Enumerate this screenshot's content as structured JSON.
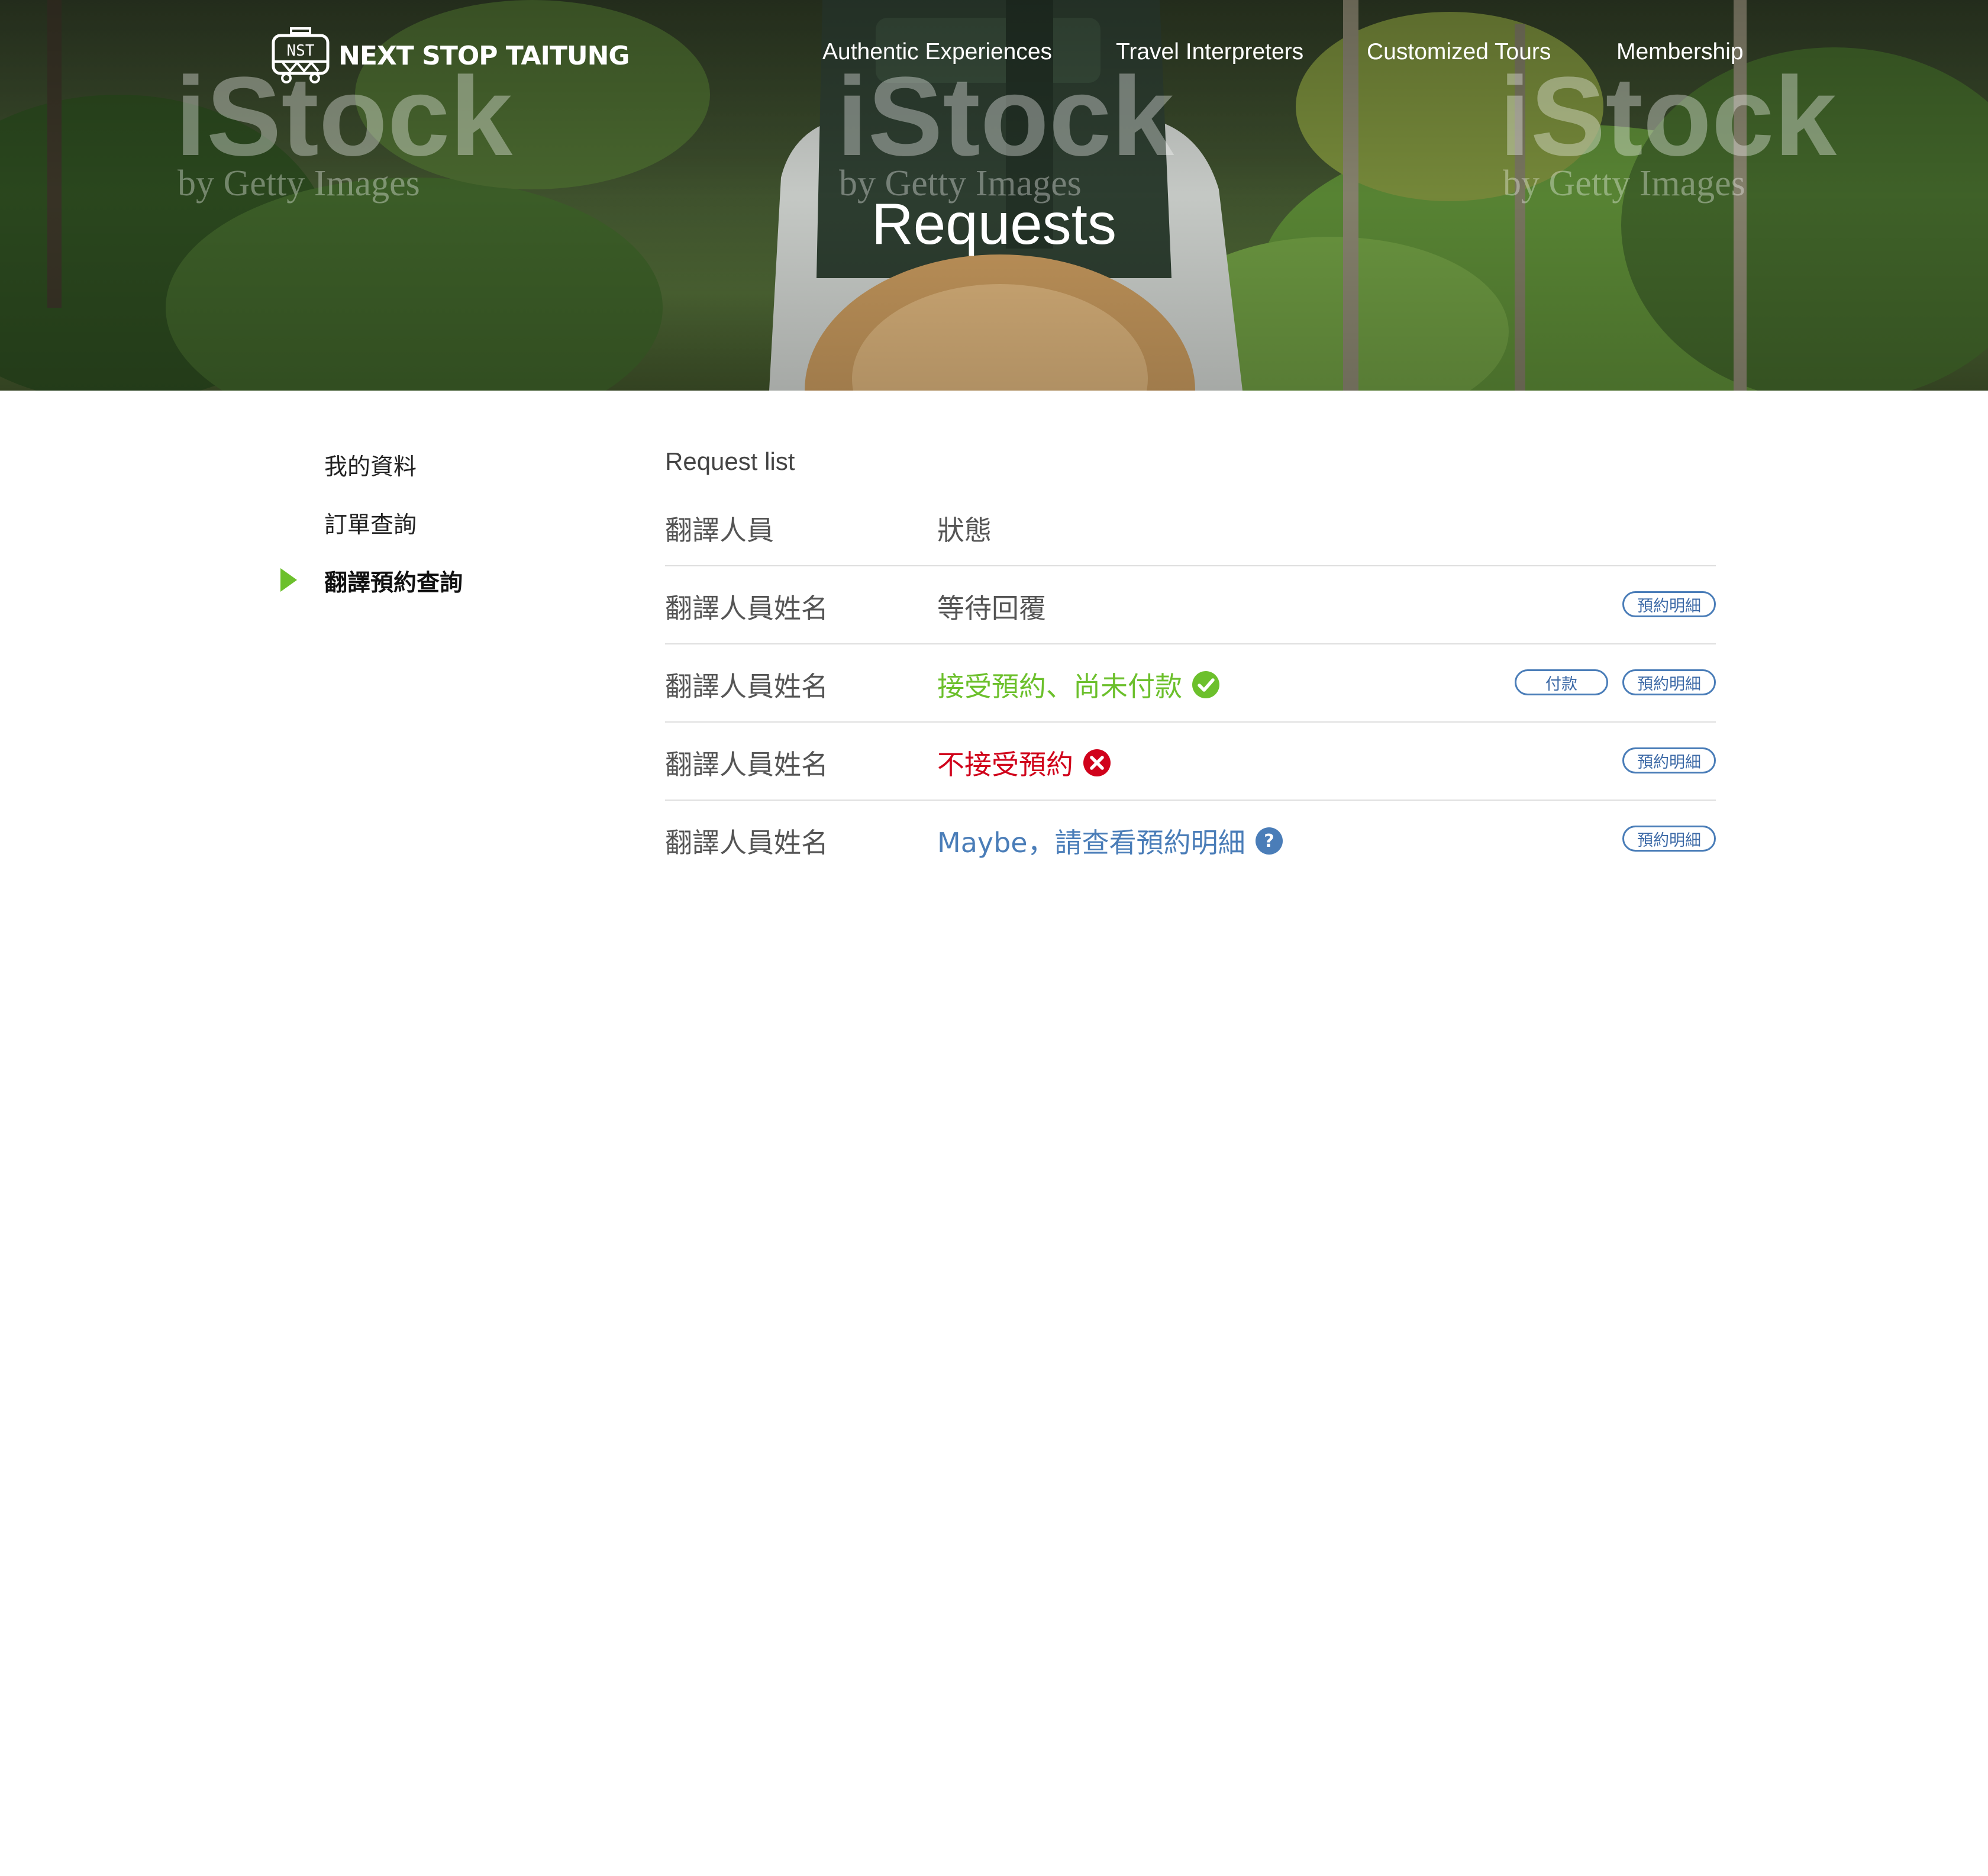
{
  "brand": {
    "logo_text": "NEXT STOP TAITUNG",
    "logo_badge": "NST"
  },
  "nav": [
    {
      "label": "Authentic Experiences"
    },
    {
      "label": "Travel Interpreters"
    },
    {
      "label": "Customized Tours"
    },
    {
      "label": "Membership"
    }
  ],
  "hero": {
    "title": "Requests",
    "watermark_main": "iStock",
    "watermark_sub": "by Getty Images"
  },
  "sidebar": {
    "items": [
      {
        "label": "我的資料"
      },
      {
        "label": "訂單查詢"
      },
      {
        "label": "翻譯預約查詢",
        "active": true
      }
    ]
  },
  "main": {
    "list_title": "Request list",
    "headers": {
      "interpreter": "翻譯人員",
      "status": "狀態"
    },
    "rows": [
      {
        "name": "翻譯人員姓名",
        "status": "等待回覆",
        "status_color": "#555555",
        "icon": "",
        "detail_label": "預約明細"
      },
      {
        "name": "翻譯人員姓名",
        "status": "接受預約、尚未付款",
        "status_color": "#6cc02c",
        "icon": "check-circle-icon",
        "pay_label": "付款",
        "detail_label": "預約明細"
      },
      {
        "name": "翻譯人員姓名",
        "status": "不接受預約",
        "status_color": "#d0021b",
        "icon": "x-circle-icon",
        "detail_label": "預約明細"
      },
      {
        "name": "翻譯人員姓名",
        "status": "Maybe，請查看預約明細",
        "status_color": "#4a7db8",
        "icon": "question-circle-icon",
        "detail_label": "預約明細"
      }
    ]
  },
  "colors": {
    "accent_green": "#6cc02c",
    "accent_blue": "#4a7db8",
    "error_red": "#d0021b"
  }
}
